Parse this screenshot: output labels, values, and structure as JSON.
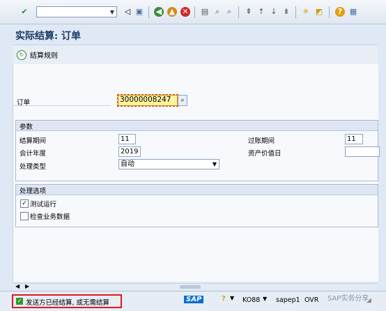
{
  "toolbar": {
    "command_field": "",
    "icons": [
      "check-icon",
      "back-icon",
      "save-icon",
      "nav-back-icon",
      "exit-icon",
      "cancel-icon",
      "print-icon",
      "find-icon",
      "find-next-icon",
      "first-page-icon",
      "prev-page-icon",
      "next-page-icon",
      "last-page-icon",
      "new-session-icon",
      "shortcut-icon",
      "help-icon",
      "layout-icon"
    ]
  },
  "title": "实际结算: 订单",
  "app_toolbar": {
    "settlement_rules": "结算规则"
  },
  "order": {
    "label": "订单",
    "value": "30000008247"
  },
  "params": {
    "title": "参数",
    "settlement_period_label": "结算期间",
    "settlement_period": "11",
    "posting_period_label": "过账期间",
    "posting_period": "11",
    "fiscal_year_label": "会计年度",
    "fiscal_year": "2019",
    "asset_value_date_label": "资产价值日",
    "asset_value_date": "",
    "processing_type_label": "处理类型",
    "processing_type": "自动"
  },
  "options": {
    "title": "处理选项",
    "test_run_label": "测试运行",
    "test_run_checked": "✓",
    "check_trans_label": "检查业务数据"
  },
  "status": {
    "message": "发送方已经结算, 或无需结算",
    "sap": "SAP",
    "transaction": "KO88",
    "server": "sapep1",
    "mode": "OVR",
    "watermark": "SAP实务分享"
  },
  "colors": {
    "accent": "#1b3a63",
    "highlight": "#fff3a0",
    "status_border": "#e0191f",
    "sap_blue": "#0a6ed1"
  }
}
